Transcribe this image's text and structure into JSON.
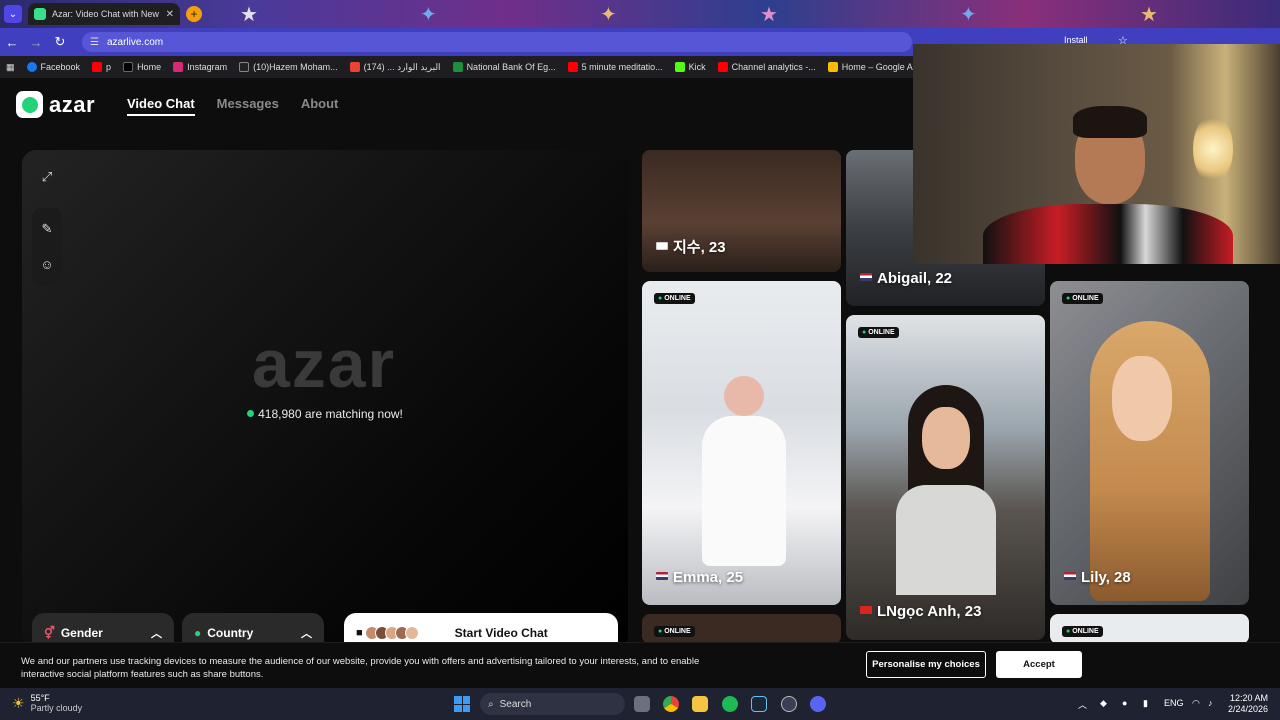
{
  "browser": {
    "tab_title": "Azar: Video Chat with New Peo",
    "url": "azarlive.com",
    "install_label": "Install",
    "bookmarks": [
      "Facebook",
      "p",
      "Home",
      "Instagram",
      "(10)Hazem Moham...",
      "(174) ... البريد الوارد",
      "National Bank Of Eg...",
      "5 minute meditatio...",
      "Kick",
      "Channel analytics -...",
      "Home – Google Ad..."
    ]
  },
  "site": {
    "logo_text": "azar",
    "nav": [
      "Video Chat",
      "Messages",
      "About"
    ],
    "big_logo": "azar",
    "matching_text": "418,980 are matching now!",
    "gender_label": "Gender",
    "country_label": "Country",
    "start_label": "Start Video Chat",
    "online_label": "ONLINE"
  },
  "profiles": [
    {
      "name": "지수, 23",
      "flag": "kr"
    },
    {
      "name": "Abigail, 22",
      "flag": "us"
    },
    {
      "name": "Emma, 25",
      "flag": "us"
    },
    {
      "name": "LNgọc Anh, 23",
      "flag": "vn"
    },
    {
      "name": "Lily, 28",
      "flag": "us"
    }
  ],
  "cookie": {
    "text": "We and our partners use tracking devices to measure the audience of our website, provide you with offers and advertising tailored to your interests, and to enable interactive social platform features such as share buttons.",
    "personalise_label": "Personalise my choices",
    "accept_label": "Accept"
  },
  "taskbar": {
    "temp": "55°F",
    "weather": "Partly cloudy",
    "search_label": "Search",
    "lang": "ENG",
    "time": "12:20 AM",
    "date": "2/24/2026"
  },
  "colors": {
    "accent_green": "#22d37a",
    "browser_toolbar": "#3f3fbf",
    "background": "#0d0d0d"
  }
}
